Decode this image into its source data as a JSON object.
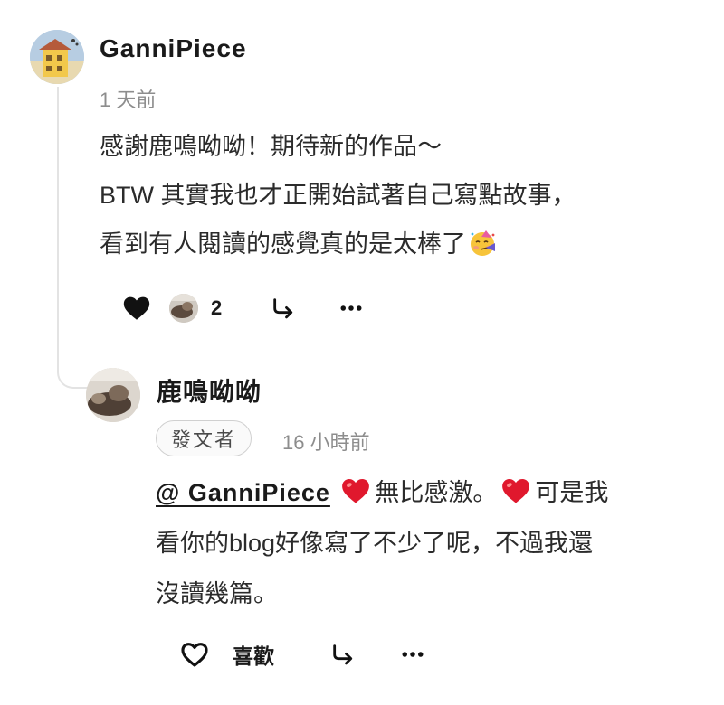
{
  "comment": {
    "username": "GanniPiece",
    "time": "1 天前",
    "lines": [
      "感謝鹿鳴呦呦！期待新的作品～",
      "BTW 其實我也才正開始試著自己寫點故事，",
      "看到有人閱讀的感覺真的是太棒了"
    ],
    "line3_emoji": "partying-face-emoji",
    "like_count": "2",
    "liked": true,
    "icons": [
      "heart-filled-icon",
      "share-arrow-icon",
      "more-icon"
    ]
  },
  "reply": {
    "username": "鹿鳴呦呦",
    "badge": "發文者",
    "time": "16 小時前",
    "mention": "@ GanniPiece",
    "line1_a": "無比感激。",
    "line1_b": "可是我",
    "line2": "看你的blog好像寫了不少了呢，不過我還",
    "line3": "沒讀幾篇。",
    "like_label": "喜歡",
    "liked": false,
    "icons": [
      "heart-outline-icon",
      "share-arrow-icon",
      "more-icon"
    ]
  },
  "colors": {
    "text": "#1a1a1a",
    "muted": "#8d8d8d",
    "heart_emoji": "#e0182d",
    "thread_line": "#e3e3e3"
  }
}
